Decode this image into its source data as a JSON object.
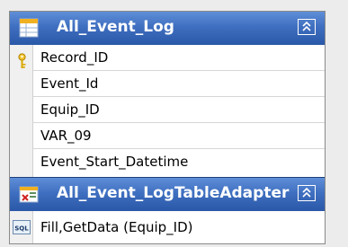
{
  "table": {
    "title": "All_Event_Log",
    "fields": [
      {
        "name": "Record_ID",
        "is_key": true
      },
      {
        "name": "Event_Id",
        "is_key": false
      },
      {
        "name": "Equip_ID",
        "is_key": false
      },
      {
        "name": "VAR_09",
        "is_key": false
      },
      {
        "name": "Event_Start_Datetime",
        "is_key": false
      }
    ]
  },
  "adapter": {
    "title": "All_Event_LogTableAdapter",
    "queries": [
      "Fill,GetData (Equip_ID)"
    ]
  },
  "icons": {
    "table": "datatable-icon",
    "adapter": "tableadapter-icon",
    "key": "primary-key-icon",
    "query": "sql-query-icon",
    "collapse": "collapse-chevron-icon"
  },
  "colors": {
    "header": "#3f6fc0",
    "header_text": "#ffffff",
    "gutter": "#f0f0f0"
  }
}
